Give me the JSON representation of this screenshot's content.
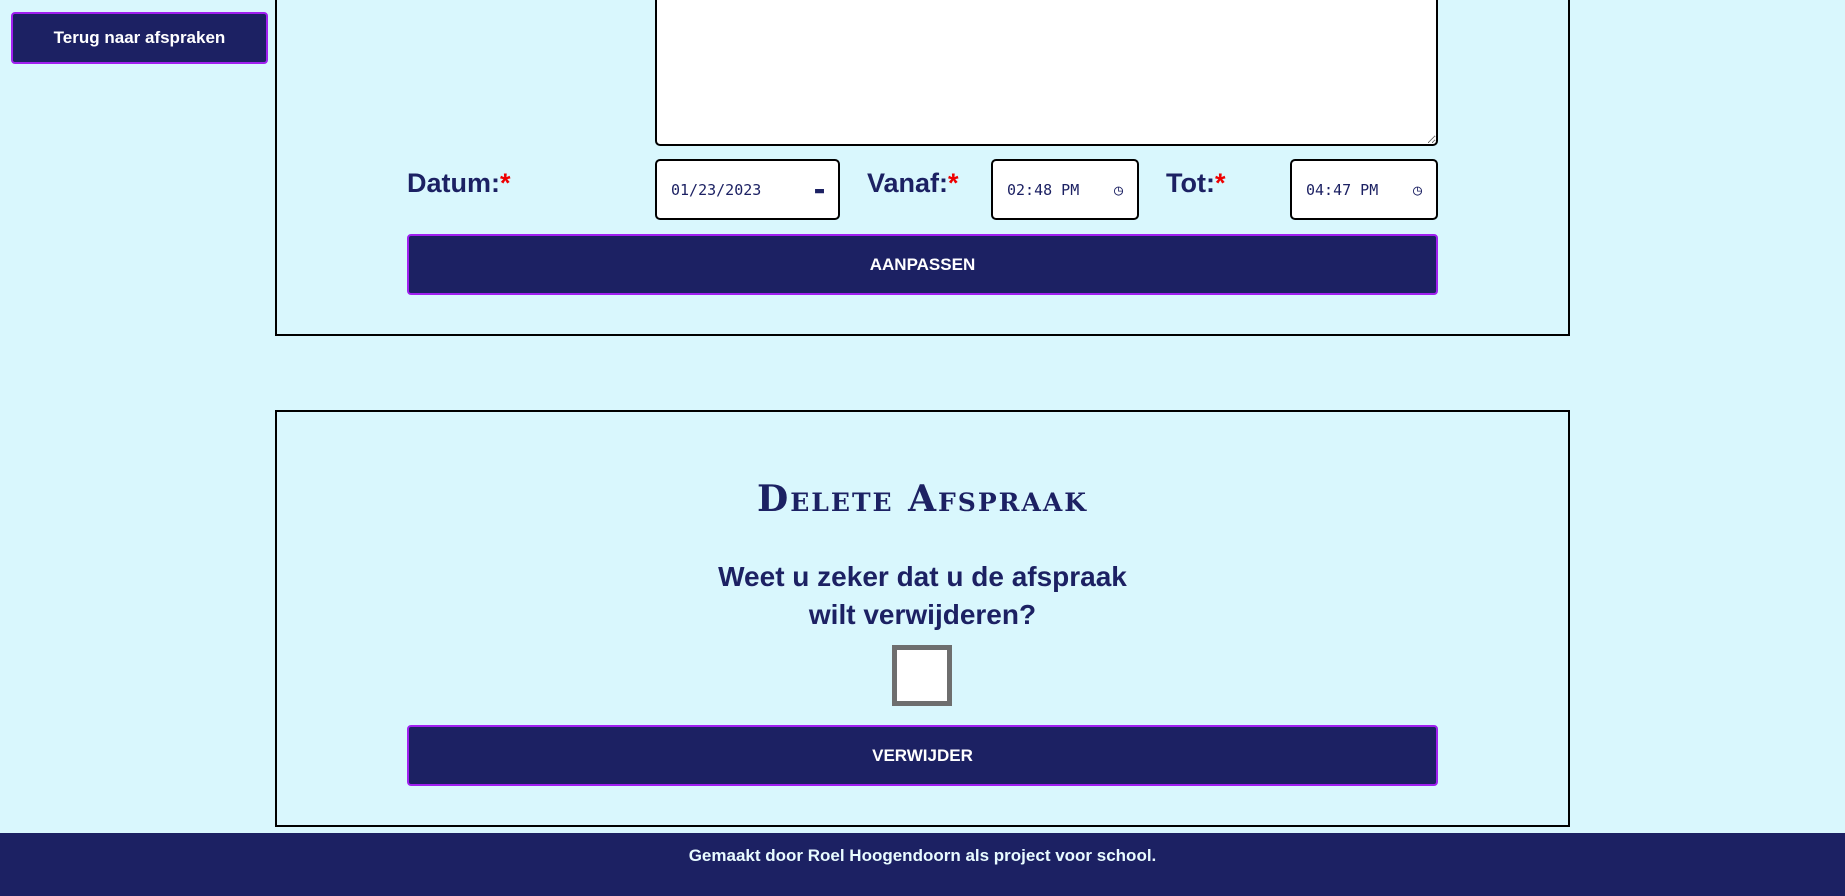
{
  "nav": {
    "back_label": "Terug naar afspraken"
  },
  "edit_form": {
    "datum_label": "Datum:",
    "vanaf_label": "Vanaf:",
    "tot_label": "Tot:",
    "required_mark": "*",
    "date_value": "01/23/2023",
    "from_value": "02:48 PM",
    "to_value": "04:47 PM",
    "submit_label": "AANPASSEN"
  },
  "delete_form": {
    "title": "Delete Afspraak",
    "question_line1": "Weet u zeker dat u de afspraak",
    "question_line2": "wilt verwijderen?",
    "confirm_checked": false,
    "submit_label": "VERWIJDER"
  },
  "footer": {
    "text": "Gemaakt door Roel Hoogendoorn als project voor school."
  },
  "colors": {
    "background": "#d9f7fd",
    "primary": "#1c2163",
    "accent_border": "#a020f0",
    "required": "#e00000"
  }
}
